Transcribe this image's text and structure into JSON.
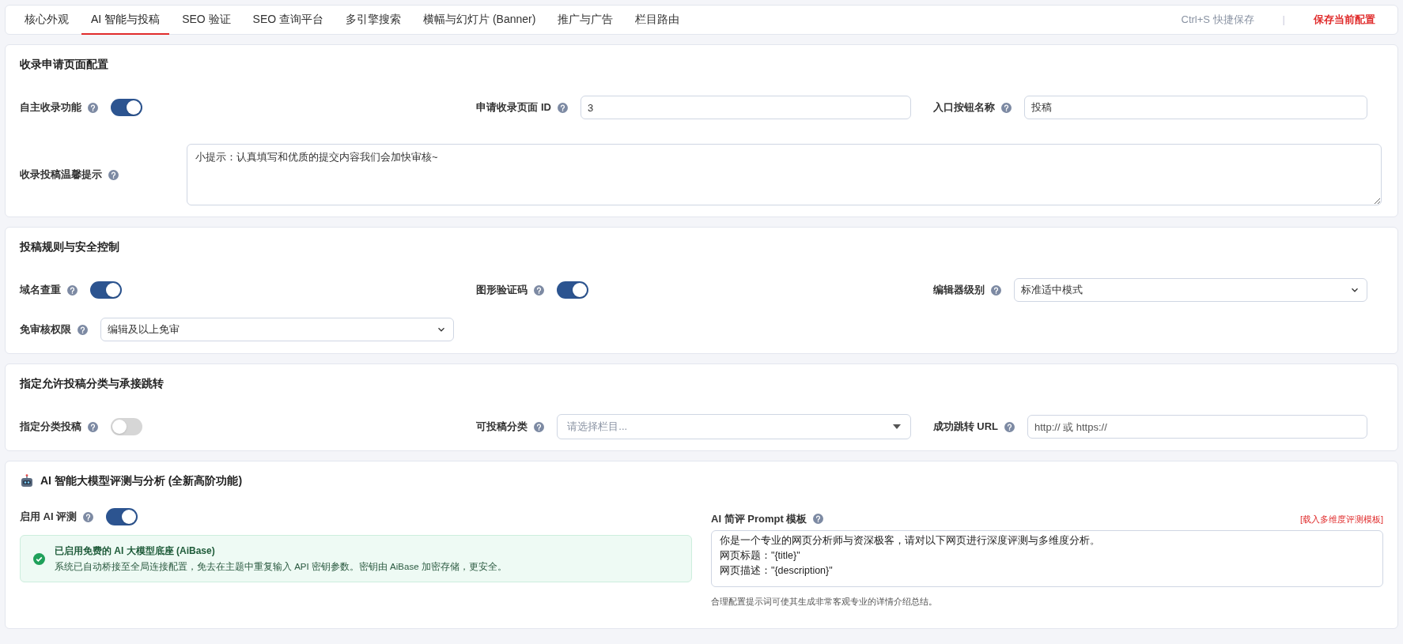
{
  "tabs": [
    {
      "label": "核心外观",
      "selected": false
    },
    {
      "label": "AI 智能与投稿",
      "selected": true
    },
    {
      "label": "SEO 验证",
      "selected": false
    },
    {
      "label": "SEO 查询平台",
      "selected": false
    },
    {
      "label": "多引擎搜索",
      "selected": false
    },
    {
      "label": "横幅与幻灯片 (Banner)",
      "selected": false
    },
    {
      "label": "推广与广告",
      "selected": false
    },
    {
      "label": "栏目路由",
      "selected": false
    }
  ],
  "shortcut_hint": "Ctrl+S 快捷保存",
  "separator": "|",
  "save_button": "保存当前配置",
  "sections": [
    {
      "title": "收录申请页面配置",
      "rows": [
        {
          "kind": "grid",
          "fields": [
            {
              "kind": "toggle",
              "label": "自主收录功能",
              "on": true
            },
            {
              "kind": "input",
              "label": "申请收录页面 ID",
              "value": "3"
            },
            {
              "kind": "input",
              "label": "入口按钮名称",
              "value": "投稿"
            }
          ]
        },
        {
          "kind": "textarea",
          "label": "收录投稿温馨提示",
          "value": "小提示：认真填写和优质的提交内容我们会加快审核~"
        }
      ]
    },
    {
      "title": "投稿规则与安全控制",
      "rows": [
        {
          "kind": "grid",
          "fields": [
            {
              "kind": "toggle",
              "label": "域名查重",
              "on": true
            },
            {
              "kind": "toggle",
              "label": "图形验证码",
              "on": true
            },
            {
              "kind": "select",
              "label": "编辑器级别",
              "value": "标准适中模式"
            }
          ]
        },
        {
          "kind": "grid",
          "fields": [
            {
              "kind": "select",
              "label": "免审核权限",
              "value": "编辑及以上免审"
            }
          ]
        }
      ]
    },
    {
      "title": "指定允许投稿分类与承接跳转",
      "rows": [
        {
          "kind": "grid",
          "fields": [
            {
              "kind": "toggle",
              "label": "指定分类投稿",
              "on": false
            },
            {
              "kind": "dropdown",
              "label": "可投稿分类",
              "placeholder": "请选择栏目..."
            },
            {
              "kind": "input",
              "label": "成功跳转 URL",
              "placeholder": "http:// 或 https://"
            }
          ]
        }
      ]
    }
  ],
  "ai_section": {
    "title": "AI 智能大模型评测与分析 (全新高阶功能)",
    "toggle": {
      "label": "启用 AI 评测",
      "on": true
    },
    "notice": {
      "title": "已启用免费的 AI 大模型底座 (AiBase)",
      "text": "系统已自动桥接至全局连接配置，免去在主题中重复输入 API 密钥参数。密钥由 AiBase 加密存储，更安全。"
    },
    "prompt": {
      "label": "AI 简评 Prompt 模板",
      "link": "[载入多维度评测模板]",
      "lines": [
        "你是一个专业的网页分析师与资深极客，请对以下网页进行深度评测与多维度分析。",
        "网页标题：\"{title}\"",
        "网页描述：\"{description}\""
      ],
      "help": "合理配置提示词可使其生成非常客观专业的详情介绍总结。"
    }
  }
}
